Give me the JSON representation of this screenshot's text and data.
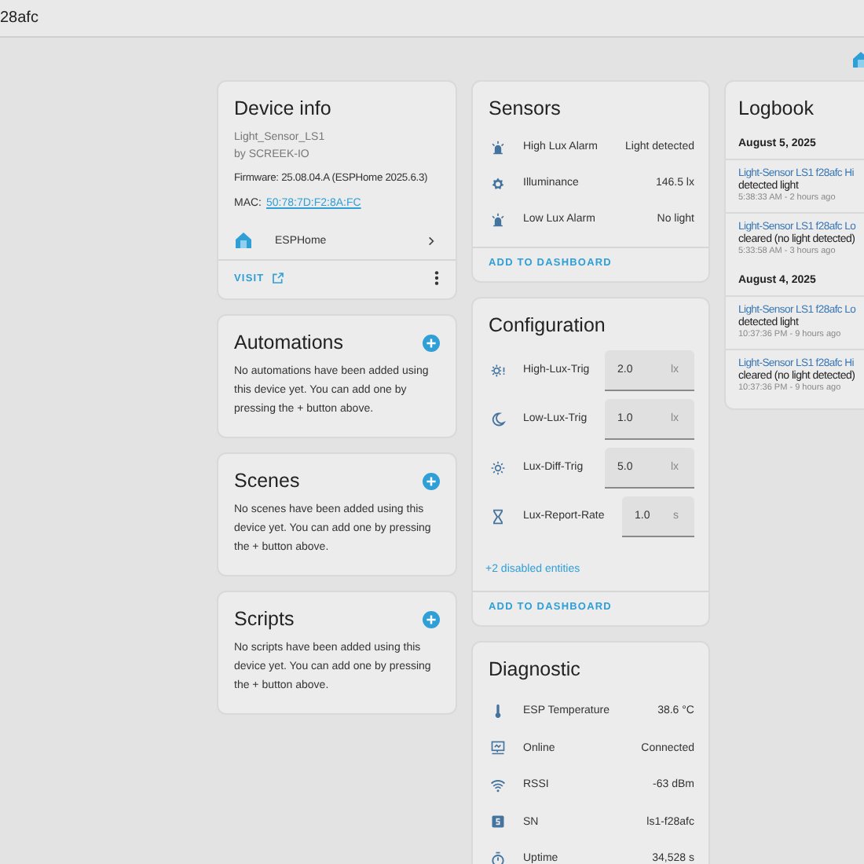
{
  "header": {
    "title": "28afc"
  },
  "device_info": {
    "title": "Device info",
    "model": "Light_Sensor_LS1",
    "manufacturer": "by SCREEK-IO",
    "firmware": "Firmware: 25.08.04.A (ESPHome 2025.6.3)",
    "mac_label": "MAC:",
    "mac": "50:78:7D:F2:8A:FC",
    "integration": "ESPHome",
    "visit": "VISIT"
  },
  "empty_sections": [
    {
      "title": "Automations",
      "message": "No automations have been added using this device yet. You can add one by pressing the + button above."
    },
    {
      "title": "Scenes",
      "message": "No scenes have been added using this device yet. You can add one by pressing the + button above."
    },
    {
      "title": "Scripts",
      "message": "No scripts have been added using this device yet. You can add one by pressing the + button above."
    }
  ],
  "sensors": {
    "title": "Sensors",
    "rows": [
      {
        "name": "High Lux Alarm",
        "value": "Light detected"
      },
      {
        "name": "Illuminance",
        "value": "146.5 lx"
      },
      {
        "name": "Low Lux Alarm",
        "value": "No light"
      }
    ],
    "action": "ADD TO DASHBOARD"
  },
  "configuration": {
    "title": "Configuration",
    "rows": [
      {
        "name": "High-Lux-Trig",
        "value": "2.0",
        "unit": "lx"
      },
      {
        "name": "Low-Lux-Trig",
        "value": "1.0",
        "unit": "lx"
      },
      {
        "name": "Lux-Diff-Trig",
        "value": "5.0",
        "unit": "lx"
      },
      {
        "name": "Lux-Report-Rate",
        "value": "1.0",
        "unit": "s"
      }
    ],
    "disabled_link": "+2 disabled entities",
    "action": "ADD TO DASHBOARD"
  },
  "diagnostic": {
    "title": "Diagnostic",
    "rows": [
      {
        "name": "ESP Temperature",
        "value": "38.6 °C"
      },
      {
        "name": "Online",
        "value": "Connected"
      },
      {
        "name": "RSSI",
        "value": "-63 dBm"
      },
      {
        "name": "SN",
        "value": "ls1-f28afc"
      },
      {
        "name": "Uptime",
        "value": "34,528 s"
      }
    ]
  },
  "logbook": {
    "title": "Logbook",
    "days": [
      {
        "date": "August 5, 2025",
        "entries": [
          {
            "source": "Light-Sensor LS1 f28afc Hi",
            "message": "detected light",
            "time": "5:38:33 AM - 2 hours ago"
          },
          {
            "source": "Light-Sensor LS1 f28afc Lo",
            "message": "cleared (no light detected)",
            "time": "5:33:58 AM - 3 hours ago"
          }
        ]
      },
      {
        "date": "August 4, 2025",
        "entries": [
          {
            "source": "Light-Sensor LS1 f28afc Lo",
            "message": "detected light",
            "time": "10:37:36 PM - 9 hours ago"
          },
          {
            "source": "Light-Sensor LS1 f28afc Hi",
            "message": "cleared (no light detected)",
            "time": "10:37:36 PM - 9 hours ago"
          }
        ]
      }
    ]
  }
}
